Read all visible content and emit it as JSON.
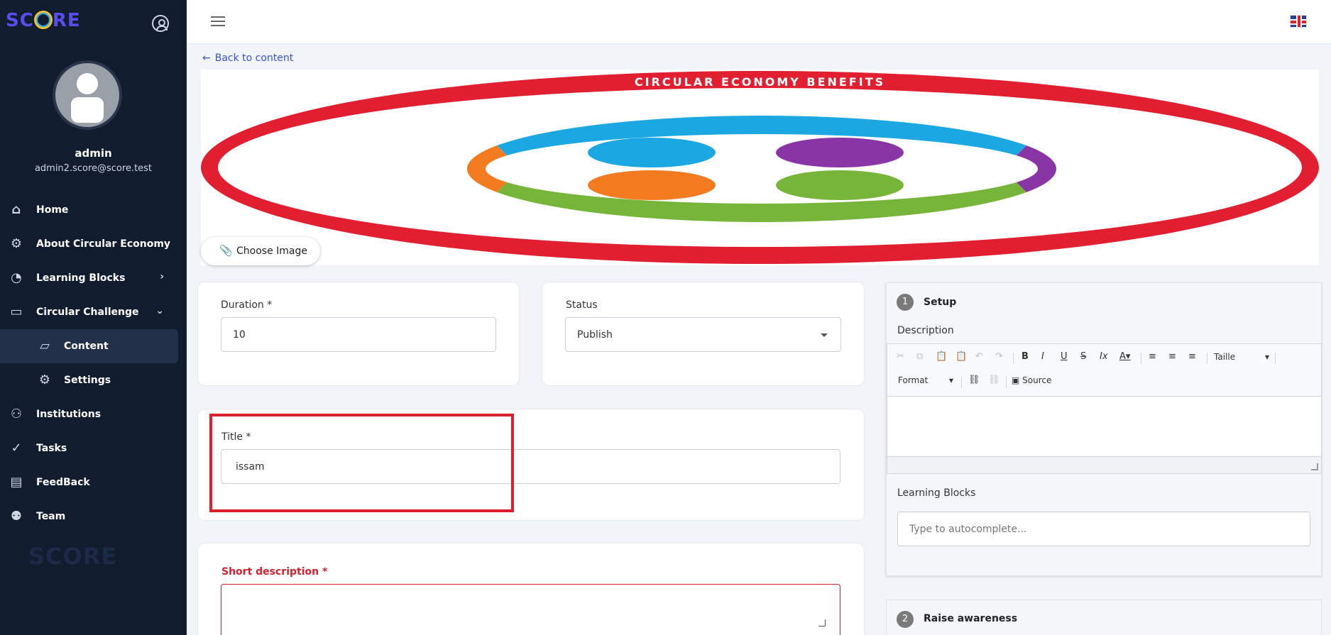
{
  "sidebar": {
    "logo": "SCORE",
    "user_name": "admin",
    "user_email": "admin2.score@score.test",
    "items": [
      {
        "label": "Home",
        "icon": "home-icon"
      },
      {
        "label": "About Circular Economy",
        "icon": "gear-icon"
      },
      {
        "label": "Learning Blocks",
        "icon": "pie-chart-icon"
      },
      {
        "label": "Circular Challenge",
        "icon": "book-icon"
      },
      {
        "label": "Content",
        "icon": "folder-icon"
      },
      {
        "label": "Settings",
        "icon": "gear-icon"
      },
      {
        "label": "Institutions",
        "icon": "users-icon"
      },
      {
        "label": "Tasks",
        "icon": "check-circle-icon"
      },
      {
        "label": "FeedBack",
        "icon": "document-icon"
      },
      {
        "label": "Team",
        "icon": "team-icon"
      }
    ]
  },
  "topbar": {
    "flag": "uk-flag"
  },
  "back_link": "Back to content",
  "banner": {
    "title": "CIRCULAR ECONOMY BENEFITS",
    "choose_image": "Choose Image"
  },
  "form": {
    "duration": {
      "label": "Duration *",
      "value": "10"
    },
    "status": {
      "label": "Status",
      "value": "Publish"
    },
    "title": {
      "label": "Title *",
      "value": "issam"
    },
    "short_description": {
      "label": "Short description *",
      "value": ""
    }
  },
  "steps": {
    "setup": {
      "num": "1",
      "title": "Setup"
    },
    "description_label": "Description",
    "toolbar": {
      "size": "Taille",
      "format": "Format",
      "source": "Source"
    },
    "learning_blocks_label": "Learning Blocks",
    "learning_blocks_placeholder": "Type to autocomplete...",
    "raise": {
      "num": "2",
      "title": "Raise awareness"
    }
  },
  "colors": {
    "sidebar_bg": "#121c2f",
    "accent": "#3a52c9",
    "error": "#d32030",
    "highlight": "#e01f2c"
  }
}
